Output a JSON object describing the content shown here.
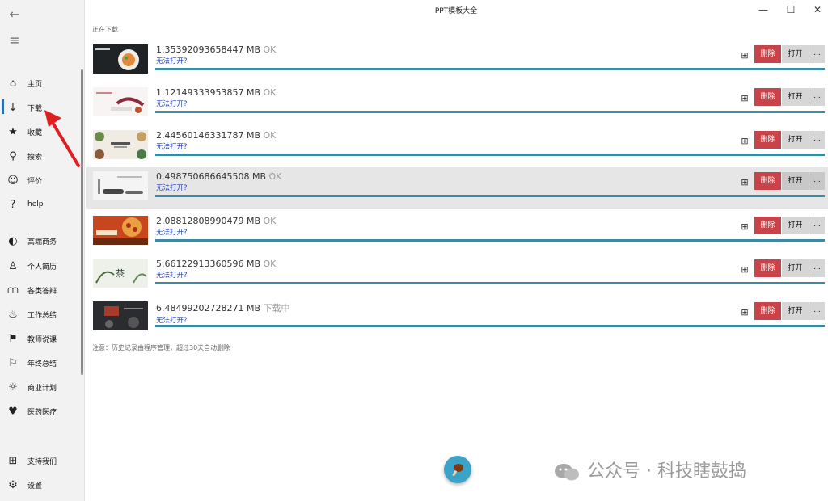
{
  "window": {
    "title": "PPT模板大全",
    "controls": {
      "minimize": "—",
      "maximize": "☐",
      "close": "✕"
    }
  },
  "sidebar": {
    "back_icon": "←",
    "menu_icon": "≡",
    "items": [
      {
        "label": "主页",
        "icon": "home-icon",
        "glyph": "⌂"
      },
      {
        "label": "下载",
        "icon": "download-icon",
        "glyph": "↓"
      },
      {
        "label": "收藏",
        "icon": "star-icon",
        "glyph": "★"
      },
      {
        "label": "搜索",
        "icon": "search-icon",
        "glyph": "⚲"
      },
      {
        "label": "评价",
        "icon": "smile-icon",
        "glyph": "☺"
      },
      {
        "label": "help",
        "icon": "question-icon",
        "glyph": "?"
      },
      {
        "label": "高端商务",
        "icon": "business-icon",
        "glyph": "◐"
      },
      {
        "label": "个人简历",
        "icon": "person-icon",
        "glyph": "♙"
      },
      {
        "label": "各类答辩",
        "icon": "chart-icon",
        "glyph": "⩋"
      },
      {
        "label": "工作总结",
        "icon": "work-icon",
        "glyph": "♨"
      },
      {
        "label": "教师说课",
        "icon": "teacher-icon",
        "glyph": "⚑"
      },
      {
        "label": "年终总结",
        "icon": "flag-icon",
        "glyph": "⚐"
      },
      {
        "label": "商业计划",
        "icon": "bulb-icon",
        "glyph": "☼"
      },
      {
        "label": "医药医疗",
        "icon": "medical-icon",
        "glyph": "♥"
      },
      {
        "label": "支持我们",
        "icon": "gift-icon",
        "glyph": "⊞"
      },
      {
        "label": "设置",
        "icon": "gear-icon",
        "glyph": "⚙"
      }
    ]
  },
  "downloads": {
    "section_label": "正在下载",
    "rows": [
      {
        "size": "1.35392093658447 MB",
        "status": "OK",
        "link": "无法打开?"
      },
      {
        "size": "1.12149333953857 MB",
        "status": "OK",
        "link": "无法打开?"
      },
      {
        "size": "2.44560146331787 MB",
        "status": "OK",
        "link": "无法打开?"
      },
      {
        "size": "0.498750686645508 MB",
        "status": "OK",
        "link": "无法打开?"
      },
      {
        "size": "2.08812808990479 MB",
        "status": "OK",
        "link": "无法打开?"
      },
      {
        "size": "5.66122913360596 MB",
        "status": "OK",
        "link": "无法打开?"
      },
      {
        "size": "6.48499202728271 MB",
        "status": "下载中",
        "link": "无法打开?"
      }
    ],
    "delete_label": "删除",
    "open_label": "打开",
    "more_label": "...",
    "note": "注意：历史记录由程序管理，超过30天自动删除"
  },
  "watermark": {
    "text": "公众号 · 科技瞎鼓捣"
  },
  "colors": {
    "accent": "#3b8aa3",
    "delete": "#c9434a",
    "link": "#1a3fbf",
    "annotation": "#e02020"
  }
}
